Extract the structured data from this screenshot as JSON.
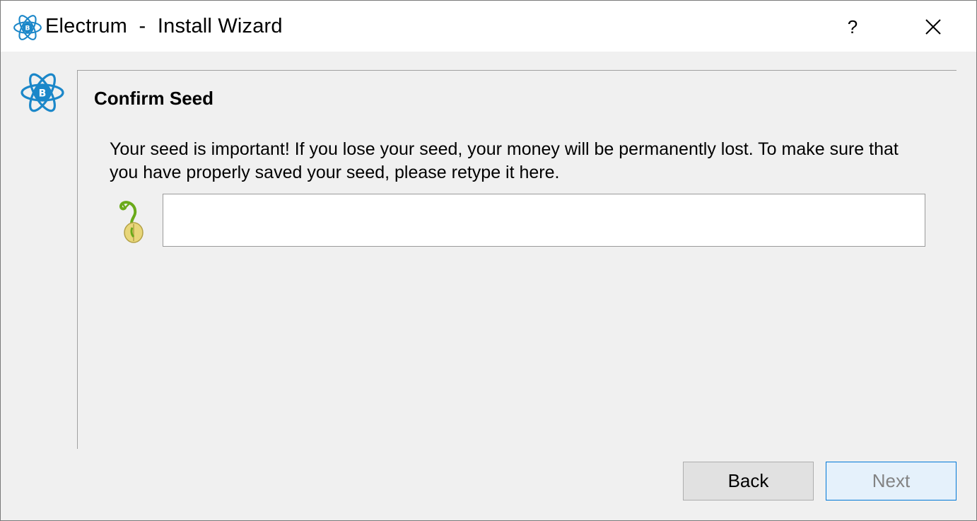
{
  "window": {
    "title": "Electrum  -  Install Wizard",
    "help_label": "?",
    "icons": {
      "app": "electrum-logo-icon",
      "close": "close-icon",
      "seed": "seed-sprout-icon"
    },
    "colors": {
      "accent": "#1b87c9",
      "next_border": "#0078d7"
    }
  },
  "page": {
    "title": "Confirm Seed",
    "message": "Your seed is important! If you lose your seed, your money will be permanently lost. To make sure that you have properly saved your seed, please retype it here.",
    "seed_value": "",
    "seed_placeholder": ""
  },
  "buttons": {
    "back": "Back",
    "next": "Next"
  }
}
